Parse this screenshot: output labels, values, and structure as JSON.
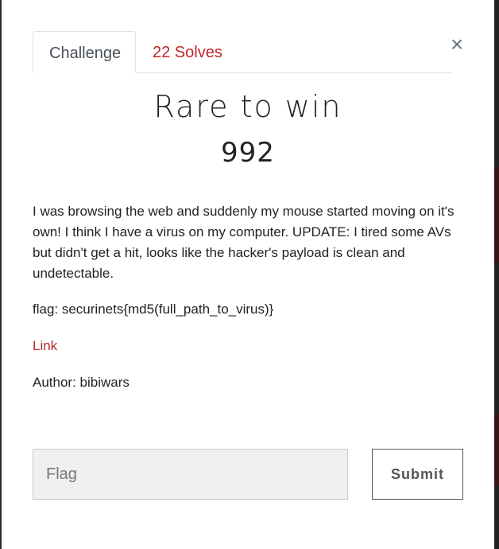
{
  "tabs": {
    "challenge_label": "Challenge",
    "solves_label": "22 Solves"
  },
  "close_symbol": "×",
  "challenge": {
    "name": "Rare to win",
    "points": "992",
    "description": "I was browsing the web and suddenly my mouse started moving on it's own! I think I have a virus on my computer. UPDATE: I tired some AVs but didn't get a hit, looks like the hacker's payload is clean and undetectable.",
    "flag_format": "flag: securinets{md5(full_path_to_virus)}",
    "link_label": "Link",
    "author": "Author: bibiwars"
  },
  "form": {
    "flag_placeholder": "Flag",
    "submit_label": "Submit"
  },
  "colors": {
    "accent": "#c0272d",
    "text": "#222222"
  }
}
